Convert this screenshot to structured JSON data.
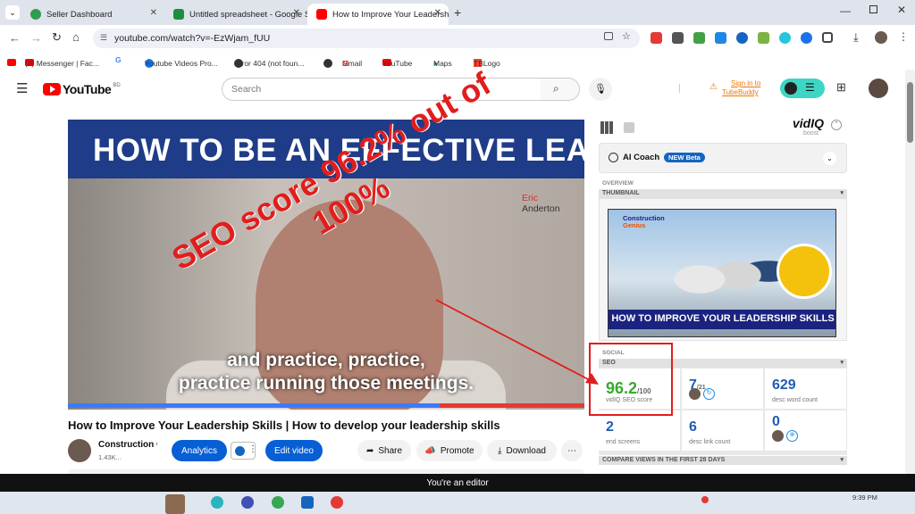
{
  "browser": {
    "tabs": [
      {
        "label": "Seller Dashboard",
        "active": false,
        "color": "#2e9d53"
      },
      {
        "label": "Untitled spreadsheet - Google Sh",
        "active": false,
        "color": "#1e8e3e"
      },
      {
        "label": "How to Improve Your Leadershi",
        "active": true,
        "color": "#ff0000"
      }
    ],
    "url": "youtube.com/watch?v=-EzWjam_fUU",
    "bookmarks": [
      {
        "label": "",
        "color": "#ff0000"
      },
      {
        "label": "(2) Messenger | Fac...",
        "color": "#ff0000"
      },
      {
        "label": "G",
        "color": "#4285f4"
      },
      {
        "label": "Youtube Videos Pro...",
        "color": "#1877f2"
      },
      {
        "label": "Error 404 (not foun...",
        "color": "#333"
      },
      {
        "label": "",
        "color": "#333"
      },
      {
        "label": "Gmail",
        "color": "#ea4335"
      },
      {
        "label": "YouTube",
        "color": "#ff0000"
      },
      {
        "label": "Maps",
        "color": "#34a853"
      },
      {
        "label": "TBLogo",
        "color": "#ea4335"
      }
    ]
  },
  "youtube": {
    "logo_text": "YouTube",
    "region": "BD",
    "search_placeholder": "Search",
    "signin": "Sign in to",
    "signin2": "TubeBuddy"
  },
  "video": {
    "banner": "HOW TO BE AN EFFECTIVE LEADER",
    "name1": "Eric",
    "name2": "Anderton",
    "caption1": "and practice, practice,",
    "caption2": "practice running those meetings.",
    "overlay1": "SEO score 96.2% out of",
    "overlay2": "100%",
    "progress_fraction": 0.72,
    "title": "How to Improve Your Leadership Skills | How to develop your leadership skills",
    "channel": "Construction G",
    "subs": "1.43K...",
    "analytics": "Analytics",
    "edit": "Edit video",
    "share": "Share",
    "promote": "Promote",
    "download": "Download"
  },
  "vidiq": {
    "brand": "vidIQ",
    "brand_sub": "boost",
    "ai_coach": "AI Coach",
    "new_badge": "NEW Beta",
    "overview": "OVERVIEW",
    "thumbnail": "THUMBNAIL",
    "thumb_brand": "Construction",
    "thumb_brand2": "Genius",
    "thumb_title": "HOW TO IMPROVE YOUR LEADERSHIP SKILLS",
    "social": "SOCIAL",
    "seo": "SEO",
    "seo_score": "96.2",
    "seo_max": "/100",
    "seo_label": "vidIQ SEO score",
    "stat2": "7",
    "stat2_max": "/21",
    "stat3": "629",
    "stat3_label": "desc word count",
    "stat4": "2",
    "stat4_label": "end screens",
    "stat5": "6",
    "stat5_label": "desc link count",
    "stat6": "0",
    "compare": "COMPARE VIEWS IN THE FIRST 28 DAYS"
  },
  "editor_bar": "You're an editor",
  "time": "9:39 PM"
}
